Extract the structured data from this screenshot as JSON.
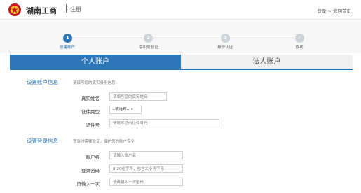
{
  "header": {
    "brand": "湖南工商",
    "subtitle": "注册",
    "links": {
      "login": "登录",
      "sep": "~",
      "home": "返回首页"
    },
    "logo_color": "#c8161d"
  },
  "steps": [
    {
      "number": "1",
      "label": "创建账户",
      "state": "active"
    },
    {
      "number": "2",
      "label": "手机号验证",
      "state": "pending"
    },
    {
      "number": "3",
      "label": "身份认证",
      "state": "pending"
    },
    {
      "number": "✓",
      "label": "成功",
      "state": "pending"
    }
  ],
  "tabs": {
    "personal": "个人账户",
    "legal": "法人账户"
  },
  "account_info": {
    "title": "设置账户信息",
    "hint": "请填写您的真实身份信息",
    "name_label": "真实姓名",
    "name_placeholder": "请填写您的真实姓名",
    "idtype_label": "证件类型",
    "idtype_value": "--请选择-- ⇕",
    "idnum_label": "证件号",
    "idnum_placeholder": "请填写您的证件号码"
  },
  "login_info": {
    "title": "设置登录信息",
    "hint": "登录时需要验证，保护您的账户安全",
    "account_label": "账户名",
    "account_placeholder": "请输入账户名",
    "password_label": "登录密码",
    "password_placeholder": "8-20位字符，包含大小写字母",
    "confirm_label": "再输入一次",
    "confirm_placeholder": "请再输入一次密码"
  },
  "colors": {
    "accent": "#2d77b8",
    "inactive_step": "#cfd3d8",
    "tab_inactive_bg": "#f0f0f0"
  }
}
